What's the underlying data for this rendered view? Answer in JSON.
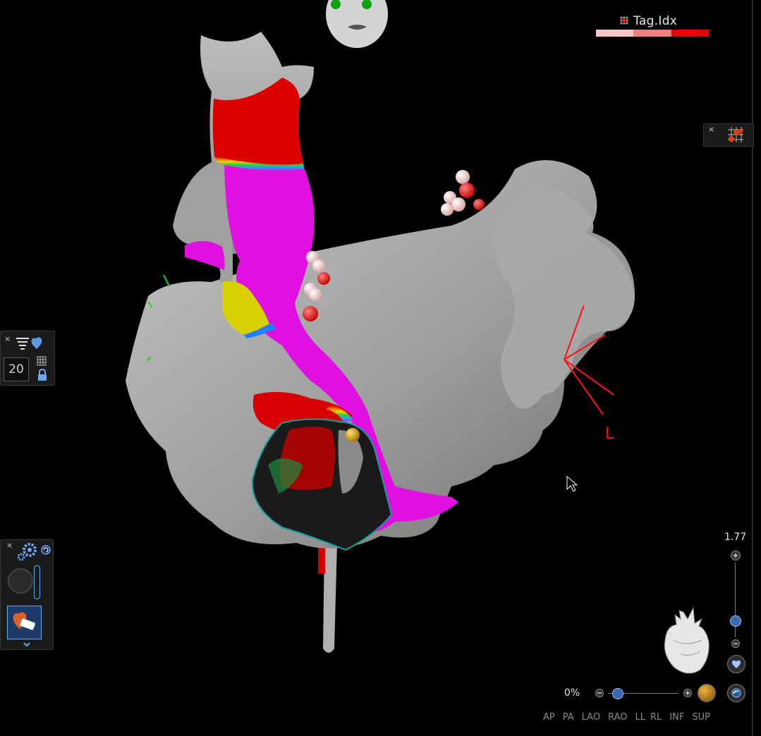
{
  "legend": {
    "title": "Tag.Idx",
    "icon": "tag-grid-icon",
    "colors": [
      "#f7c6c6",
      "#f07f7f",
      "#e80000"
    ]
  },
  "orientation_label": "L",
  "left_panel": {
    "frame_value": "20",
    "icons": [
      "menu-heart-icon",
      "grid-icon",
      "lock-icon"
    ]
  },
  "bottom_left_panel": {
    "icons": [
      "settings-gear-icon",
      "refresh-icon",
      "circle-button-icon",
      "heart-eraser-icon",
      "chevron-down-icon",
      "resize-grip-icon"
    ]
  },
  "right_panel": {
    "icons": [
      "tag-grid-icon"
    ]
  },
  "zoom": {
    "value": "1.77",
    "icons": [
      "zoom-in-icon",
      "zoom-out-icon",
      "heart-view-icon"
    ]
  },
  "opacity": {
    "value": "0%",
    "fraction": 0.05,
    "icons": [
      "minus-icon",
      "plus-icon",
      "sphere-icon",
      "rotate-icon"
    ]
  },
  "view_buttons": [
    "AP",
    "PA",
    "LAO",
    "RAO",
    "LL",
    "RL",
    "INF",
    "SUP"
  ],
  "colors": {
    "background": "#000000",
    "surface": "#9d9d9d",
    "activation_magenta": "#e010e0",
    "activation_red": "#e00000",
    "tag_red": "#e80000",
    "tag_pink": "#f4c9c9"
  }
}
